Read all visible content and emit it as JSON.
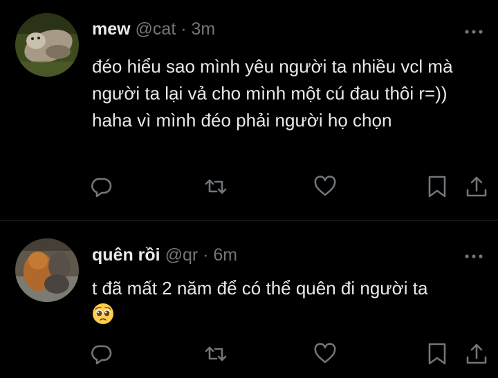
{
  "tweets": [
    {
      "name": "mew",
      "handle": "@cat",
      "separator": " · ",
      "time": "3m",
      "text": "đéo hiểu sao mình yêu người ta nhiều vcl mà người ta lại vả cho mình một cú đau thôi r=)) haha vì mình đéo phải người họ chọn"
    },
    {
      "name": "quên rồi",
      "handle": "@qr",
      "separator": " · ",
      "time": "6m",
      "text": "t đã mất 2 năm để có thể quên đi người ta",
      "emoji": "pleading-face"
    }
  ],
  "colors": {
    "background": "#000000",
    "text": "#e7e9ea",
    "secondary": "#71767b",
    "divider": "#2f3336"
  },
  "icons": [
    "more-icon",
    "reply-icon",
    "retweet-icon",
    "like-icon",
    "bookmark-icon",
    "share-icon"
  ]
}
